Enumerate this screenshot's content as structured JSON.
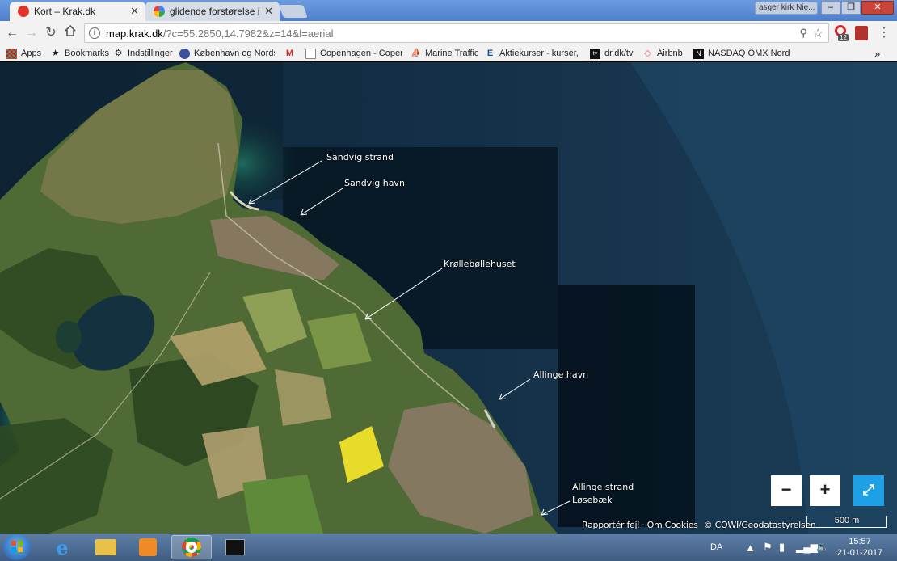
{
  "browser": {
    "tabs": [
      {
        "title": "Kort – Krak.dk",
        "favicon": "krak-icon",
        "active": true
      },
      {
        "title": "glidende forstørelse i kra",
        "favicon": "google-icon",
        "active": false
      }
    ],
    "user_chip": "asger kirk Nie...",
    "window_controls": {
      "minimize": "–",
      "maximize": "❐",
      "close": "✕"
    }
  },
  "toolbar": {
    "url_host": "map.krak.dk",
    "url_rest": "/?c=55.2850,14.7982&z=14&l=aerial",
    "extension_badge": "12"
  },
  "bookmarks": [
    {
      "label": "Apps",
      "icon": "apps-grid-icon"
    },
    {
      "label": "Bookmarks",
      "icon": "star-icon"
    },
    {
      "label": "Indstillinger",
      "icon": "gear-icon"
    },
    {
      "label": "København og Nords",
      "icon": "globe-icon"
    },
    {
      "label": "",
      "icon": "gmail-icon"
    },
    {
      "label": "Copenhagen - Copen",
      "icon": "page-icon"
    },
    {
      "label": "Marine Traffic",
      "icon": "ship-icon"
    },
    {
      "label": "Aktiekurser - kurser, n",
      "icon": "ei-icon"
    },
    {
      "label": "dr.dk/tv",
      "icon": "tv-icon"
    },
    {
      "label": "Airbnb",
      "icon": "airbnb-icon"
    },
    {
      "label": "NASDAQ OMX Nordic",
      "icon": "nasdaq-icon"
    }
  ],
  "bookmarks_overflow": "»",
  "map": {
    "labels": [
      {
        "name": "sandvig-strand",
        "text": "Sandvig strand"
      },
      {
        "name": "sandvig-havn",
        "text": "Sandvig havn"
      },
      {
        "name": "krollebollehuset",
        "text": "Krøllebøllehuset"
      },
      {
        "name": "allinge-havn",
        "text": "Allinge havn"
      },
      {
        "name": "allinge-strand",
        "text": "Allinge strand"
      },
      {
        "name": "losebaek",
        "text": "Løsebæk"
      }
    ],
    "controls": {
      "zoom_out": "−",
      "zoom_in": "+",
      "fullscreen": "⤢"
    },
    "attribution": {
      "report": "Rapportér fejl",
      "sep": "·",
      "cookies": "Om Cookies",
      "copyright": "© COWI/Geodatastyrelsen"
    },
    "scale_label": "500 m"
  },
  "taskbar": {
    "language": "DA",
    "time": "15:57",
    "date": "21-01-2017"
  }
}
